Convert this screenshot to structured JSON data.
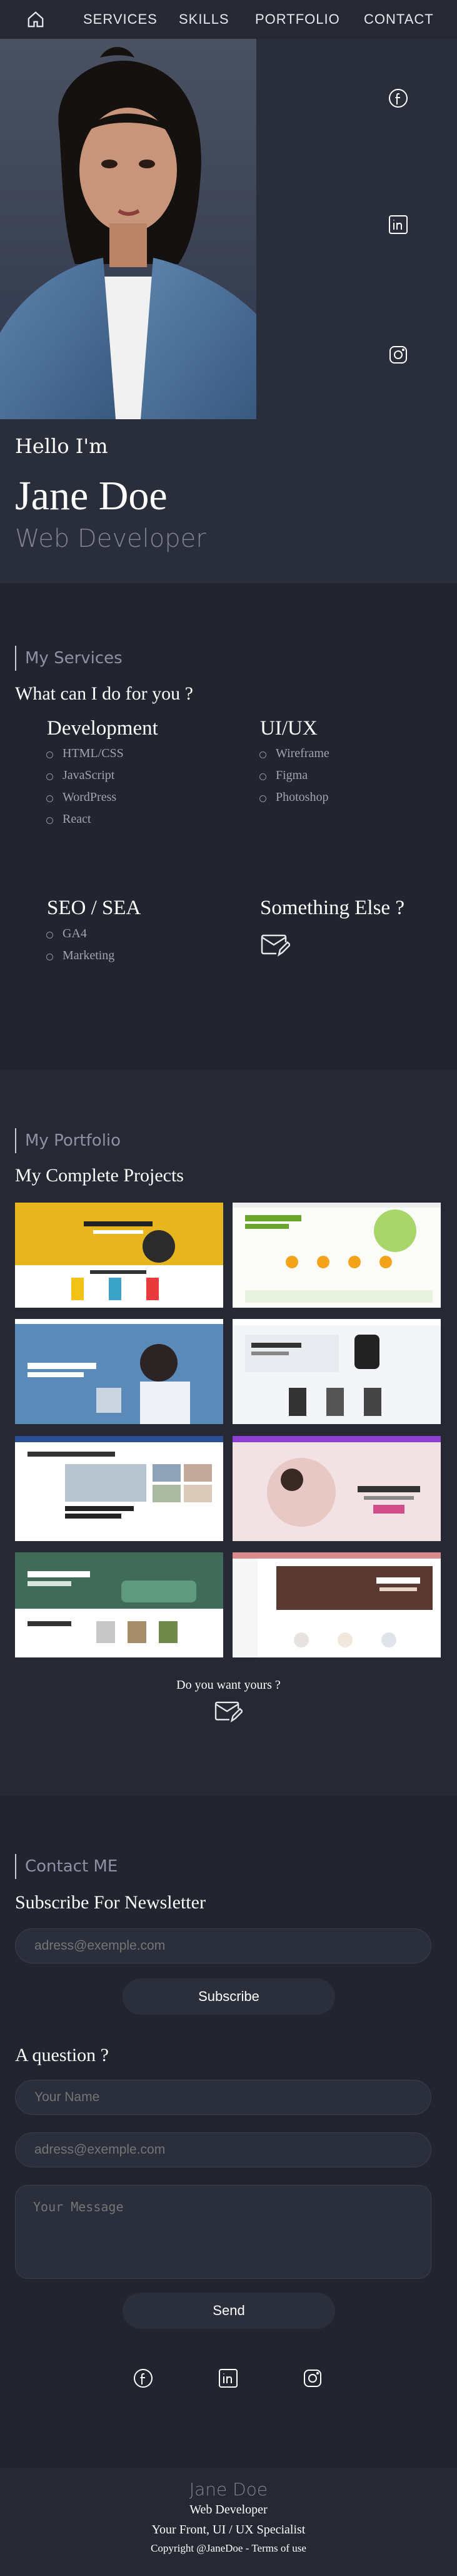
{
  "nav": {
    "home_icon": "home-icon",
    "links": [
      "SERVICES",
      "SKILLS",
      "PORTFOLIO",
      "CONTACT"
    ]
  },
  "hero": {
    "social_icons": [
      "facebook-icon",
      "linkedin-icon",
      "instagram-icon"
    ],
    "greeting": "Hello I'm",
    "name": "Jane Doe",
    "role": "Web Developer"
  },
  "services": {
    "section_title": "My Services",
    "heading": "What can I do for you ?",
    "groups": [
      {
        "title": "Development",
        "items": [
          "HTML/CSS",
          "JavaScript",
          "WordPress",
          "React"
        ]
      },
      {
        "title": "UI/UX",
        "items": [
          "Wireframe",
          "Figma",
          "Photoshop"
        ]
      },
      {
        "title": "SEO / SEA",
        "items": [
          "GA4",
          "Marketing"
        ]
      },
      {
        "title": "Something Else ?",
        "items": []
      }
    ]
  },
  "portfolio": {
    "section_title": "My Portfolio",
    "heading": "My Complete Projects",
    "cta": "Do you want yours ?"
  },
  "contact": {
    "section_title": "Contact ME",
    "newsletter_heading": "Subscribe For Newsletter",
    "newsletter_placeholder": "adress@exemple.com",
    "subscribe_label": "Subscribe",
    "question_heading": "A question ?",
    "name_placeholder": "Your Name",
    "email_placeholder": "adress@exemple.com",
    "message_placeholder": "Your Message",
    "send_label": "Send"
  },
  "footer": {
    "name": "Jane Doe",
    "role": "Web Developer",
    "tagline": "Your Front, UI / UX Specialist",
    "copyright": "Copyright @JaneDoe - Terms of use"
  },
  "colors": {
    "background": "#22242f",
    "panel": "#2a2d3a",
    "muted_text": "#7f8293"
  }
}
